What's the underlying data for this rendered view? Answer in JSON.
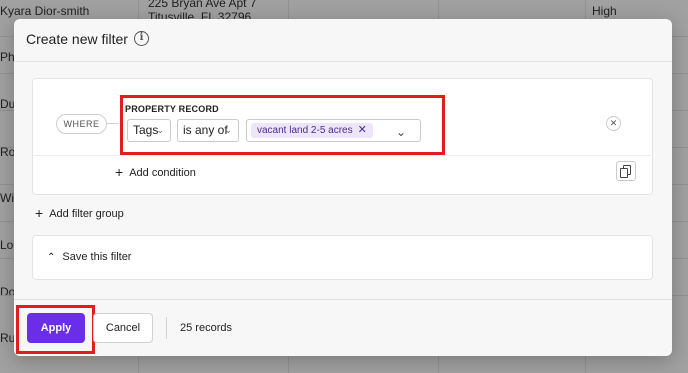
{
  "background": {
    "rows": [
      {
        "name": "Kyara Dior-smith",
        "address": "225 Bryan Ave Apt 7",
        "address2": "Titusville, FL 32796",
        "priority": "High"
      },
      {
        "name": "Phi"
      },
      {
        "name": "Du"
      },
      {
        "name": "Ro"
      },
      {
        "name": "Wi"
      },
      {
        "name": "Lo"
      },
      {
        "name": "Do"
      },
      {
        "name": "Ru"
      }
    ]
  },
  "modal": {
    "title": "Create new filter",
    "info_icon": "info-icon",
    "where_label": "WHERE",
    "condition": {
      "section_label": "PROPERTY RECORD",
      "field": "Tags",
      "operator": "is any of",
      "value_chip": "vacant land 2-5 acres",
      "remove_chip_icon": "close-icon",
      "dropdown_icon": "chevron-down-icon"
    },
    "add_condition_label": "Add condition",
    "add_group_label": "Add filter group",
    "save_filter_label": "Save this filter",
    "apply_label": "Apply",
    "cancel_label": "Cancel",
    "records_label": "25 records",
    "colors": {
      "accent": "#6a2ee6",
      "highlight": "#e11d1d",
      "chip_bg": "#ede6fb"
    }
  }
}
